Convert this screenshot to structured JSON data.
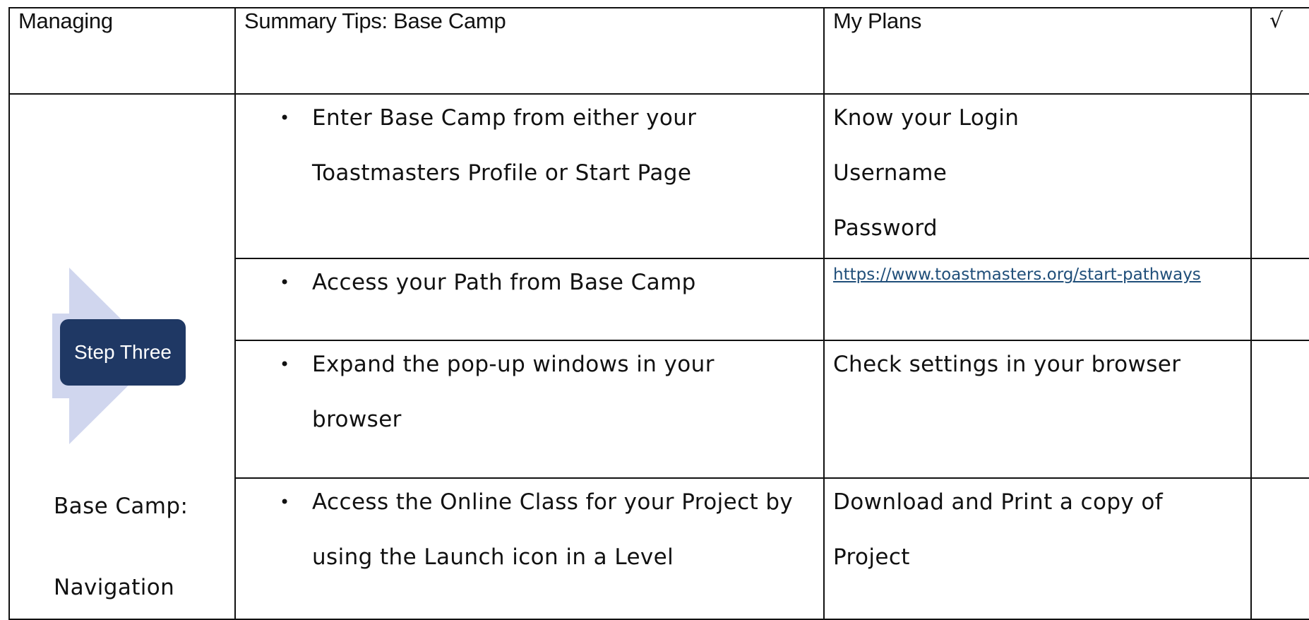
{
  "header": {
    "col1": "Managing",
    "col2": "Summary Tips: Base Camp",
    "col3": "My Plans",
    "col4": "√"
  },
  "left": {
    "step_label": "Step Three",
    "line1": "Base Camp:",
    "line2": "Navigation"
  },
  "rows": [
    {
      "tip_lines": [
        "Enter Base Camp from either your",
        "Toastmasters Profile or Start Page"
      ],
      "plan_lines": [
        "Know your Login",
        "Username",
        "Password"
      ]
    },
    {
      "tip_lines": [
        "Access your Path from Base Camp"
      ],
      "plan_link": "https://www.toastmasters.org/start-pathways"
    },
    {
      "tip_lines": [
        "Expand the pop-up windows in your",
        "browser"
      ],
      "plan_lines": [
        "Check settings in your browser"
      ]
    },
    {
      "tip_lines": [
        "Access the Online Class for your Project by",
        "using the Launch icon in a Level"
      ],
      "plan_lines": [
        "Download and Print a copy of",
        "Project"
      ]
    }
  ],
  "colors": {
    "step_box": "#1f3864",
    "arrow": "#d0d6ee",
    "link": "#1f4e79"
  },
  "icons": {
    "bullet": "•"
  }
}
